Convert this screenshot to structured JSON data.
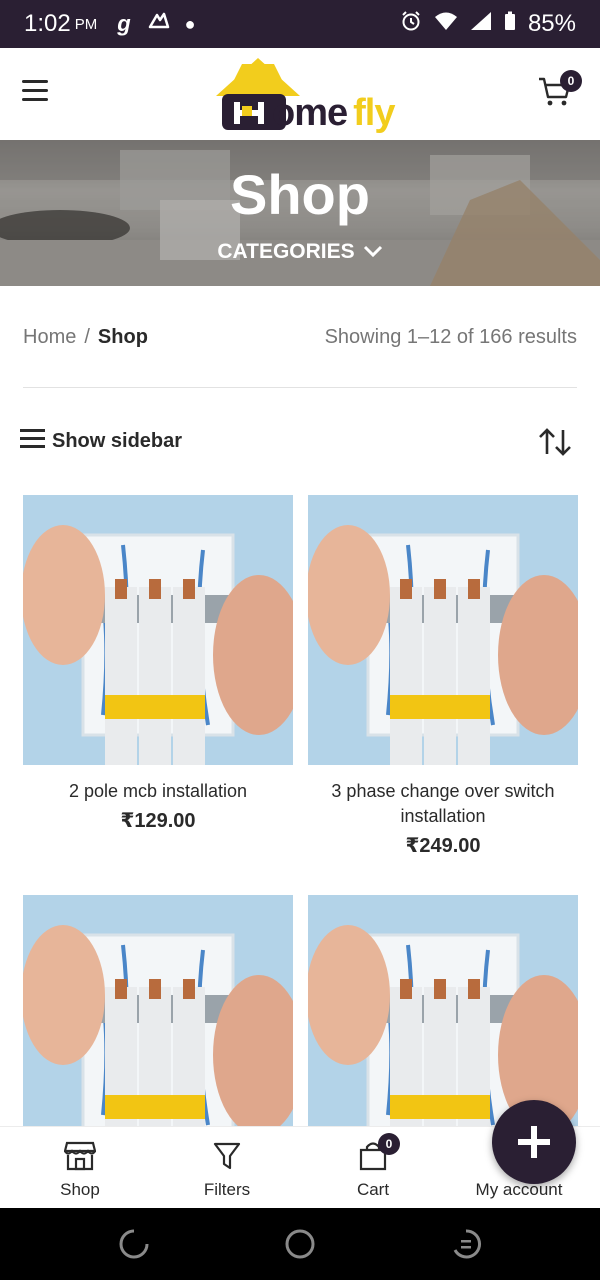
{
  "status_bar": {
    "time": "1:02",
    "ampm": "PM",
    "notif_g": "g",
    "battery": "85%"
  },
  "header": {
    "logo": {
      "brand_h": "H",
      "brand_rest": "ome",
      "brand_fly": "fly"
    },
    "cart_count": "0"
  },
  "hero": {
    "title": "Shop",
    "categories_label": "CATEGORIES"
  },
  "breadcrumb": {
    "home": "Home",
    "separator": "/",
    "current": "Shop"
  },
  "results_text": "Showing 1–12 of 166 results",
  "toolbar": {
    "sidebar_label": "Show sidebar"
  },
  "products": [
    {
      "name": "2 pole mcb installation",
      "price": "₹129.00"
    },
    {
      "name": "3 phase change over switch installation",
      "price": "₹249.00"
    },
    {
      "name": "",
      "price": ""
    },
    {
      "name": "",
      "price": ""
    }
  ],
  "bottom_nav": {
    "items": [
      {
        "label": "Shop",
        "icon": "store-icon"
      },
      {
        "label": "Filters",
        "icon": "filter-icon"
      },
      {
        "label": "Cart",
        "icon": "cart-bag-icon",
        "badge": "0"
      },
      {
        "label": "My account",
        "icon": "user-icon"
      }
    ]
  },
  "colors": {
    "brand_dark": "#2a1f33",
    "brand_yellow": "#f2cd1d",
    "text": "#2a2a2a",
    "muted": "#767676"
  }
}
